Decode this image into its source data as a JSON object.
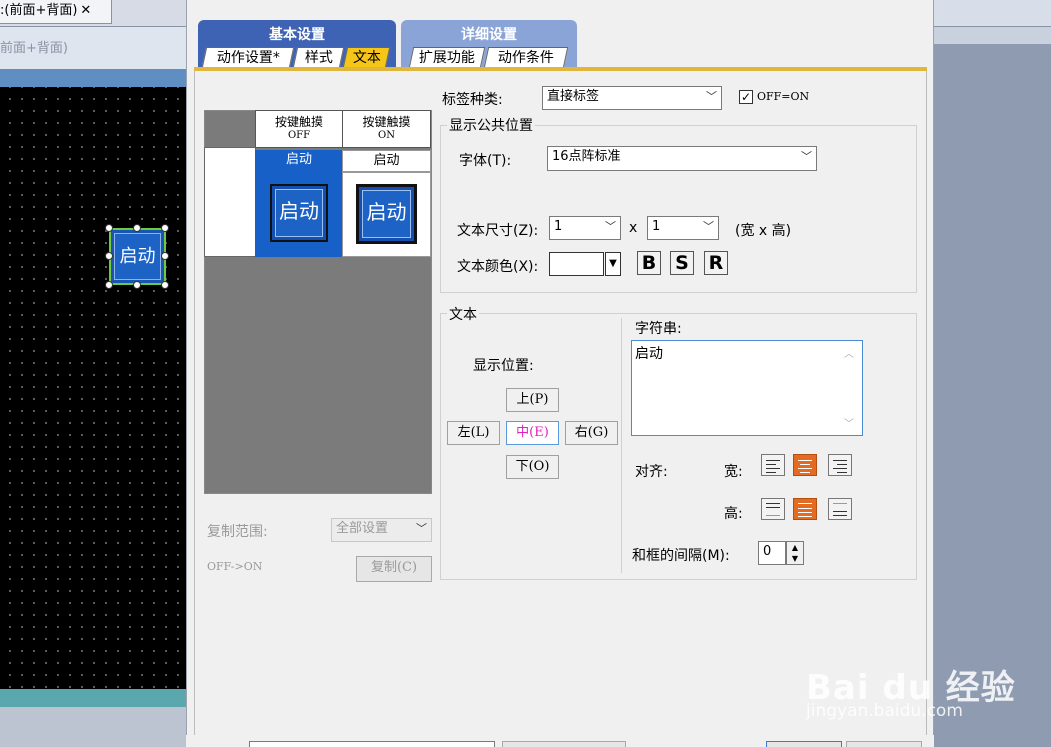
{
  "editor": {
    "doc_tab_label": ":(前面+背面)",
    "doc_tab_close": "✕",
    "view_label": "前面+背面)",
    "canvas_button_text": "启动"
  },
  "dialog": {
    "main_tabs": [
      {
        "title": "基本设置",
        "subtabs": [
          "动作设置*",
          "样式",
          "文本"
        ],
        "active_subtab": "文本"
      },
      {
        "title": "详细设置",
        "subtabs": [
          "扩展功能",
          "动作条件"
        ]
      }
    ],
    "preview": {
      "col_off_line1": "按键触摸",
      "col_off_line2": "OFF",
      "col_on_line1": "按键触摸",
      "col_on_line2": "ON",
      "row_label_off": "启动",
      "row_label_on": "启动",
      "button_off_text": "启动",
      "button_on_text": "启动"
    },
    "copy": {
      "range_label": "复制范围:",
      "range_value": "全部设置",
      "direction_label": "OFF->ON",
      "copy_button": "复制(C)"
    },
    "label_type": {
      "label": "标签种类:",
      "value": "直接标签",
      "off_on_checkbox": "OFF=ON",
      "checked": true
    },
    "common_display": {
      "legend": "显示公共位置",
      "font_label": "字体(T):",
      "font_value": "16点阵标准",
      "size_label": "文本尺寸(Z):",
      "size_w": "1",
      "size_x": "x",
      "size_h": "1",
      "size_hint": "(宽 x 高)",
      "color_label": "文本颜色(X):",
      "style_buttons": [
        "B",
        "S",
        "R"
      ]
    },
    "text_group": {
      "legend": "文本",
      "position_label": "显示位置:",
      "btn_up": "上(P)",
      "btn_left": "左(L)",
      "btn_center": "中(E)",
      "btn_right": "右(G)",
      "btn_down": "下(O)",
      "string_label": "字符串:",
      "string_value": "启动",
      "align_label": "对齐:",
      "width_label": "宽:",
      "height_label": "高:",
      "frame_gap_label": "和框的间隔(M):",
      "frame_gap_value": "0"
    }
  },
  "watermark": {
    "logo": "Bai du 经验",
    "url": "jingyan.baidu.com"
  }
}
